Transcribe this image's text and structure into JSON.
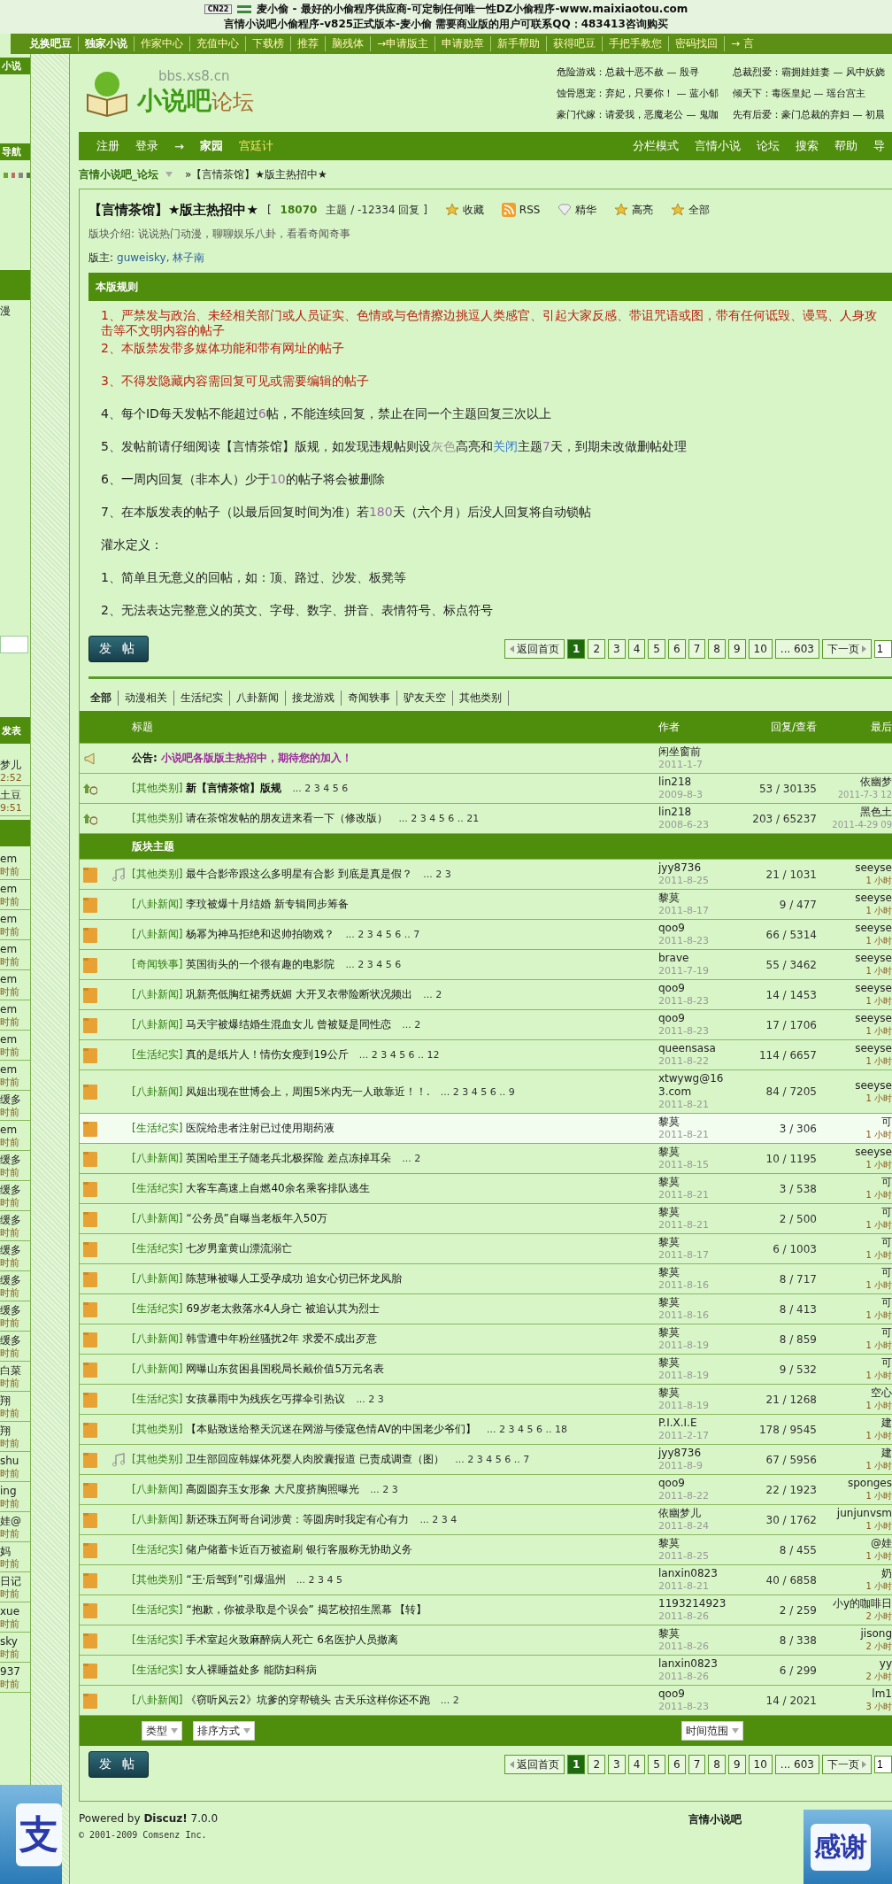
{
  "top_banner": {
    "widget": "CN22",
    "lines": [
      "麦小偷 - 最好的小偷程序供应商-可定制任何唯一性DZ小偷程序-www.maixiaotou.com",
      "言情小说吧小偷程序-v825正式版本-麦小偷  需要商业版的用户可联系QQ：483413咨询购买"
    ]
  },
  "top_nav": [
    "兑换吧豆",
    "独家小说",
    "作家中心",
    "充值中心",
    "下载榜",
    "推荐",
    "脑残体",
    "→申请版主",
    "申请勋章",
    "新手帮助",
    "获得吧豆",
    "手把手教您",
    "密码找回",
    "→ 言"
  ],
  "sidebar": {
    "header": "小说",
    "nav_label": "导航",
    "label": "漫",
    "post_label": "发表",
    "items": [
      {
        "name": "梦儿",
        "time": "2:52"
      },
      {
        "name": "土豆",
        "time": "9:51"
      },
      {
        "name": "em",
        "time": "时前"
      },
      {
        "name": "em",
        "time": "时前"
      },
      {
        "name": "em",
        "time": "时前"
      },
      {
        "name": "em",
        "time": "时前"
      },
      {
        "name": "em",
        "time": "时前"
      },
      {
        "name": "em",
        "time": "时前"
      },
      {
        "name": "em",
        "time": "时前"
      },
      {
        "name": "em",
        "time": "时前"
      },
      {
        "name": "缓多",
        "time": "时前"
      },
      {
        "name": "em",
        "time": "时前"
      },
      {
        "name": "缓多",
        "time": "时前"
      },
      {
        "name": "缓多",
        "time": "时前"
      },
      {
        "name": "缓多",
        "time": "时前"
      },
      {
        "name": "缓多",
        "time": "时前"
      },
      {
        "name": "缓多",
        "time": "时前"
      },
      {
        "name": "缓多",
        "time": "时前"
      },
      {
        "name": "缓多",
        "time": "时前"
      },
      {
        "name": "白菜",
        "time": "时前"
      },
      {
        "name": "翔",
        "time": "时前"
      },
      {
        "name": "翔",
        "time": "时前"
      },
      {
        "name": "shu",
        "time": "时前"
      },
      {
        "name": "ing",
        "time": "时前"
      },
      {
        "name": "娃@",
        "time": "时前"
      },
      {
        "name": "妈",
        "time": "时前"
      },
      {
        "name": "日记",
        "time": "时前"
      },
      {
        "name": "xue",
        "time": "时前"
      },
      {
        "name": "sky",
        "time": "时前"
      },
      {
        "name": "937",
        "time": "时前"
      }
    ]
  },
  "header": {
    "domain": "bbs.xs8.cn",
    "logo_main": "小说吧",
    "logo_sub": "论坛",
    "promos": [
      "危险游戏：总裁十恶不赦 — 殷寻",
      "总裁烈爱：霸拥娃娃妻 — 风中妖娆",
      "蚀骨恩宠：弃妃，只要你！ — 蓝小郁",
      "倾天下：毒医皇妃 — 瑶台宫主",
      "豪门代嫁：请爱我，恶魔老公 — 鬼咖",
      "先有后爱：豪门总裁的弃妇 — 初晨"
    ]
  },
  "nav": {
    "left": [
      {
        "label": "注册",
        "kind": "plain"
      },
      {
        "label": "登录",
        "kind": "plain"
      },
      {
        "label": "→",
        "kind": "plain"
      },
      {
        "label": "家园",
        "kind": "strong"
      },
      {
        "label": "宫廷计",
        "kind": "accent"
      }
    ],
    "right": [
      "分栏模式",
      "言情小说",
      "论坛",
      "搜索",
      "帮助",
      "导"
    ]
  },
  "breadcrumb": {
    "home": "言情小说吧_论坛",
    "separator": "»",
    "current": "【言情茶馆】★版主热招中★"
  },
  "forum": {
    "title": "【言情茶馆】★版主热招中★",
    "stats_open": "[",
    "topics": "18070",
    "stats_rest": "主题 / -12334 回复 ]",
    "actions": [
      {
        "label": "收藏",
        "kind": "star"
      },
      {
        "label": "RSS",
        "kind": "rss"
      },
      {
        "label": "精华",
        "kind": "diamond"
      },
      {
        "label": "高亮",
        "kind": "star"
      },
      {
        "label": "全部",
        "kind": "star"
      }
    ],
    "intro": "版块介绍: 说说热门动漫，聊聊娱乐八卦，看看奇闻奇事",
    "moderators_label": "版主:",
    "moderators": "guweisky, 林子南"
  },
  "rules": {
    "title": "本版规则",
    "items": [
      {
        "kind": "warning",
        "parts": [
          {
            "text": "1、严禁发与政治、未经相关部门或人员证实、色情或与色情擦边挑逗人类感官、引起大家反感、带诅咒语或图，带有任何诋毁、谩骂、人身攻击等不文明内容的帖子",
            "kind": "plain"
          }
        ]
      },
      {
        "kind": "warning",
        "parts": [
          {
            "text": "2、本版禁发带多媒体功能和带有网址的帖子",
            "kind": "plain"
          }
        ]
      },
      {
        "kind": "warning",
        "parts": [
          {
            "text": "3、不得发隐藏内容需回复可见或需要编辑的帖子",
            "kind": "plain"
          }
        ]
      },
      {
        "kind": "normal",
        "parts": [
          {
            "text": "4、每个ID每天发帖不能超过",
            "kind": "plain"
          },
          {
            "text": "6",
            "kind": "number"
          },
          {
            "text": "帖，不能连续回复，禁止在同一个主题回复三次以上",
            "kind": "plain"
          }
        ]
      },
      {
        "kind": "normal",
        "parts": [
          {
            "text": "5、发帖前请仔细阅读【言情茶馆】版规，如发现违规帖则设",
            "kind": "plain"
          },
          {
            "text": "灰色",
            "kind": "grey"
          },
          {
            "text": "高亮和",
            "kind": "plain"
          },
          {
            "text": "关闭",
            "kind": "blue"
          },
          {
            "text": "主题",
            "kind": "plain"
          },
          {
            "text": "7",
            "kind": "number"
          },
          {
            "text": "天，到期未改做删帖处理",
            "kind": "plain"
          }
        ]
      },
      {
        "kind": "normal",
        "parts": [
          {
            "text": "6、一周内回复（非本人）少于",
            "kind": "plain"
          },
          {
            "text": "10",
            "kind": "number"
          },
          {
            "text": "的帖子将会被删除",
            "kind": "plain"
          }
        ]
      },
      {
        "kind": "normal",
        "parts": [
          {
            "text": "7、在本版发表的帖子（以最后回复时间为准）若",
            "kind": "plain"
          },
          {
            "text": "180",
            "kind": "number"
          },
          {
            "text": "天（六个月）后没人回复将自动锁帖",
            "kind": "plain"
          }
        ]
      },
      {
        "kind": "normal",
        "parts": [
          {
            "text": "灌水定义：",
            "kind": "plain"
          }
        ]
      },
      {
        "kind": "normal",
        "parts": [
          {
            "text": "1、简单且无意义的回帖，如：顶、路过、沙发、板凳等",
            "kind": "plain"
          }
        ]
      },
      {
        "kind": "normal",
        "parts": [
          {
            "text": "2、无法表达完整意义的英文、字母、数字、拼音、表情符号、标点符号",
            "kind": "plain"
          }
        ]
      }
    ]
  },
  "pager_top": {
    "post_button": "发 帖",
    "back": "返回首页",
    "pages": [
      {
        "label": "1",
        "selected": true
      },
      {
        "label": "2",
        "selected": false
      },
      {
        "label": "3",
        "selected": false
      },
      {
        "label": "4",
        "selected": false
      },
      {
        "label": "5",
        "selected": false
      },
      {
        "label": "6",
        "selected": false
      },
      {
        "label": "7",
        "selected": false
      },
      {
        "label": "8",
        "selected": false
      },
      {
        "label": "9",
        "selected": false
      },
      {
        "label": "10",
        "selected": false
      },
      {
        "label": "... 603",
        "selected": false
      }
    ],
    "next": "下一页",
    "jump": "1"
  },
  "filters": [
    {
      "label": "全部",
      "selected": true
    },
    {
      "label": "动漫相关",
      "selected": false
    },
    {
      "label": "生活纪实",
      "selected": false
    },
    {
      "label": "八卦新闻",
      "selected": false
    },
    {
      "label": "接龙游戏",
      "selected": false
    },
    {
      "label": "奇闻轶事",
      "selected": false
    },
    {
      "label": "驴友天空",
      "selected": false
    },
    {
      "label": "其他类别",
      "selected": false
    }
  ],
  "table": {
    "columns": [
      "标题",
      "作者",
      "回复/查看",
      "最后"
    ],
    "announcement": {
      "label": "公告:",
      "text": "小说吧各版版主热招中，期待您的加入！",
      "author": "闲坐窗前",
      "date": "2011-1-7"
    },
    "sticky": [
      {
        "category": "[其他类别]",
        "title": "新【言情茶馆】版规",
        "pages": "... 2 3 4 5 6",
        "author": "lin218",
        "date": "2009-8-3",
        "counts": "53 / 30135",
        "last_user": "依幽梦",
        "last_time": "2011-7-3 12"
      },
      {
        "category": "[其他类别]",
        "title": "请在茶馆发帖的朋友进来看一下（修改版）",
        "pages": "... 2 3 4 5 6 .. 21",
        "author": "lin218",
        "date": "2008-6-23",
        "counts": "203 / 65237",
        "last_user": "黑色土",
        "last_time": "2011-4-29 09"
      }
    ],
    "section": "版块主题",
    "threads": [
      {
        "category": "[其他类别]",
        "title": "最牛合影帝跟这么多明星有合影 到底是真是假？",
        "pages": "... 2 3",
        "author": "jyy8736",
        "date": "2011-8-25",
        "counts": "21 / 1031",
        "last_user": "seeyse",
        "last_time": "1 小时",
        "audio": true,
        "highlighted": false
      },
      {
        "category": "[八卦新闻]",
        "title": "李玟被爆十月结婚 新专辑同步筹备",
        "author": "黎莫",
        "date": "2011-8-17",
        "counts": "9 / 477",
        "last_user": "seeyse",
        "last_time": "1 小时",
        "audio": false,
        "highlighted": false
      },
      {
        "category": "[八卦新闻]",
        "title": "杨幂为神马拒绝和迟帅拍吻戏？",
        "pages": "... 2 3 4 5 6 .. 7",
        "author": "qoo9",
        "date": "2011-8-23",
        "counts": "66 / 5314",
        "last_user": "seeyse",
        "last_time": "1 小时",
        "audio": false,
        "highlighted": false
      },
      {
        "category": "[奇闻轶事]",
        "title": "英国街头的一个很有趣的电影院",
        "pages": "... 2 3 4 5 6",
        "author": "brave",
        "date": "2011-7-19",
        "counts": "55 / 3462",
        "last_user": "seeyse",
        "last_time": "1 小时",
        "audio": false,
        "highlighted": false
      },
      {
        "category": "[八卦新闻]",
        "title": "巩新亮低胸红裙秀妩媚 大开叉衣带险断状况频出",
        "pages": "... 2",
        "author": "qoo9",
        "date": "2011-8-23",
        "counts": "14 / 1453",
        "last_user": "seeyse",
        "last_time": "1 小时",
        "audio": false,
        "highlighted": false
      },
      {
        "category": "[八卦新闻]",
        "title": "马天宇被爆结婚生混血女儿 曾被疑是同性恋",
        "pages": "... 2",
        "author": "qoo9",
        "date": "2011-8-23",
        "counts": "17 / 1706",
        "last_user": "seeyse",
        "last_time": "1 小时",
        "audio": false,
        "highlighted": false
      },
      {
        "category": "[生活纪实]",
        "title": "真的是纸片人！情伤女瘦到19公斤",
        "pages": "... 2 3 4 5 6 .. 12",
        "author": "queensasa",
        "date": "2011-8-22",
        "counts": "114 / 6657",
        "last_user": "seeyse",
        "last_time": "1 小时",
        "audio": false,
        "highlighted": false
      },
      {
        "category": "[八卦新闻]",
        "title": "凤姐出现在世博会上，周围5米内无一人敢靠近！！.",
        "pages": "... 2 3 4 5 6 .. 9",
        "author": "xtwywg@163.com",
        "date": "2011-8-21",
        "counts": "84 / 7205",
        "last_user": "seeyse",
        "last_time": "1 小时",
        "audio": false,
        "highlighted": false
      },
      {
        "category": "[生活纪实]",
        "title": "医院给患者注射已过使用期药液",
        "author": "黎莫",
        "date": "2011-8-21",
        "counts": "3 / 306",
        "last_user": "可",
        "last_time": "1 小时",
        "audio": false,
        "highlighted": true
      },
      {
        "category": "[八卦新闻]",
        "title": "英国哈里王子随老兵北极探险 差点冻掉耳朵",
        "pages": "... 2",
        "author": "黎莫",
        "date": "2011-8-15",
        "counts": "10 / 1195",
        "last_user": "seeyse",
        "last_time": "1 小时",
        "audio": false,
        "highlighted": false
      },
      {
        "category": "[生活纪实]",
        "title": "大客车高速上自燃40余名乘客排队逃生",
        "author": "黎莫",
        "date": "2011-8-21",
        "counts": "3 / 538",
        "last_user": "可",
        "last_time": "1 小时",
        "audio": false,
        "highlighted": false
      },
      {
        "category": "[八卦新闻]",
        "title": "“公务员”自曝当老板年入50万",
        "author": "黎莫",
        "date": "2011-8-21",
        "counts": "2 / 500",
        "last_user": "可",
        "last_time": "1 小时",
        "audio": false,
        "highlighted": false
      },
      {
        "category": "[生活纪实]",
        "title": "七岁男童黄山漂流溺亡",
        "author": "黎莫",
        "date": "2011-8-17",
        "counts": "6 / 1003",
        "last_user": "可",
        "last_time": "1 小时",
        "audio": false,
        "highlighted": false
      },
      {
        "category": "[八卦新闻]",
        "title": "陈慧琳被曝人工受孕成功 追女心切已怀龙凤胎",
        "author": "黎莫",
        "date": "2011-8-16",
        "counts": "8 / 717",
        "last_user": "可",
        "last_time": "1 小时",
        "audio": false,
        "highlighted": false
      },
      {
        "category": "[生活纪实]",
        "title": "69岁老太救落水4人身亡 被追认其为烈士",
        "author": "黎莫",
        "date": "2011-8-16",
        "counts": "8 / 413",
        "last_user": "可",
        "last_time": "1 小时",
        "audio": false,
        "highlighted": false
      },
      {
        "category": "[八卦新闻]",
        "title": "韩雪遭中年粉丝骚扰2年 求爱不成出歹意",
        "author": "黎莫",
        "date": "2011-8-19",
        "counts": "8 / 859",
        "last_user": "可",
        "last_time": "1 小时",
        "audio": false,
        "highlighted": false
      },
      {
        "category": "[八卦新闻]",
        "title": "网曝山东贫困县国税局长戴价值5万元名表",
        "author": "黎莫",
        "date": "2011-8-19",
        "counts": "9 / 532",
        "last_user": "可",
        "last_time": "1 小时",
        "audio": false,
        "highlighted": false
      },
      {
        "category": "[生活纪实]",
        "title": "女孩暴雨中为残疾乞丐撑伞引热议",
        "pages": "... 2 3",
        "author": "黎莫",
        "date": "2011-8-19",
        "counts": "21 / 1268",
        "last_user": "空心",
        "last_time": "1 小时",
        "audio": false,
        "highlighted": false
      },
      {
        "category": "[其他类别]",
        "title": "【本贴致送给整天沉迷在网游与倭寇色情AV的中国老少爷们】",
        "pages": "... 2 3 4 5 6 .. 18",
        "author": "P.I.X.I.E",
        "date": "2011-2-17",
        "counts": "178 / 9545",
        "last_user": "建",
        "last_time": "1 小时",
        "audio": false,
        "highlighted": false
      },
      {
        "category": "[其他类别]",
        "title": "卫生部回应韩媒体死婴人肉胶囊报道 已责成调查（图）",
        "pages": "... 2 3 4 5 6 .. 7",
        "author": "jyy8736",
        "date": "2011-8-9",
        "counts": "67 / 5956",
        "last_user": "建",
        "last_time": "1 小时",
        "audio": true,
        "highlighted": false
      },
      {
        "category": "[八卦新闻]",
        "title": "高圆圆弃玉女形象 大尺度挤胸照曝光",
        "pages": "... 2 3",
        "author": "qoo9",
        "date": "2011-8-22",
        "counts": "22 / 1923",
        "last_user": "sponges",
        "last_time": "1 小时",
        "audio": false,
        "highlighted": false
      },
      {
        "category": "[八卦新闻]",
        "title": "新还珠五阿哥台词涉黄：等圆房时我定有心有力",
        "pages": "... 2 3 4",
        "author": "依幽梦儿",
        "date": "2011-8-24",
        "counts": "30 / 1762",
        "last_user": "junjunvsm",
        "last_time": "1 小时",
        "audio": false,
        "highlighted": false
      },
      {
        "category": "[生活纪实]",
        "title": "储户储蓄卡近百万被盗刷 银行客服称无协助义务",
        "author": "黎莫",
        "date": "2011-8-25",
        "counts": "8 / 455",
        "last_user": "@娃",
        "last_time": "1 小时",
        "audio": false,
        "highlighted": false
      },
      {
        "category": "[其他类别]",
        "title": "“王·后驾到”引爆温州",
        "pages": "... 2 3 4 5",
        "author": "lanxin0823",
        "date": "2011-8-21",
        "counts": "40 / 6858",
        "last_user": "奶",
        "last_time": "1 小时",
        "audio": false,
        "highlighted": false
      },
      {
        "category": "[生活纪实]",
        "title": "“抱歉，你被录取是个误会” 揭艺校招生黑幕 【转】",
        "author": "1193214923",
        "date": "2011-8-26",
        "counts": "2 / 259",
        "last_user": "小y的咖啡日",
        "last_time": "2 小时",
        "audio": false,
        "highlighted": false
      },
      {
        "category": "[生活纪实]",
        "title": "手术室起火致麻醉病人死亡 6名医护人员撤离",
        "author": "黎莫",
        "date": "2011-8-26",
        "counts": "8 / 338",
        "last_user": "jisong",
        "last_time": "2 小时",
        "audio": false,
        "highlighted": false
      },
      {
        "category": "[生活纪实]",
        "title": "女人裸睡益处多 能防妇科病",
        "author": "lanxin0823",
        "date": "2011-8-26",
        "counts": "6 / 299",
        "last_user": "yy",
        "last_time": "2 小时",
        "audio": false,
        "highlighted": false
      },
      {
        "category": "[八卦新闻]",
        "title": "《窃听风云2》坑爹的穿帮镜头 古天乐这样你还不跑",
        "pages": "... 2",
        "author": "qoo9",
        "date": "2011-8-23",
        "counts": "14 / 2021",
        "last_user": "lm1",
        "last_time": "3 小时",
        "audio": false,
        "highlighted": false
      }
    ]
  },
  "table_footer": {
    "selects": [
      "类型",
      "排序方式",
      "时间范围"
    ]
  },
  "pager_bottom": {
    "post_button": "发 帖",
    "back": "返回首页",
    "pages": [
      {
        "label": "1",
        "selected": true
      },
      {
        "label": "2",
        "selected": false
      },
      {
        "label": "3",
        "selected": false
      },
      {
        "label": "4",
        "selected": false
      },
      {
        "label": "5",
        "selected": false
      },
      {
        "label": "6",
        "selected": false
      },
      {
        "label": "7",
        "selected": false
      },
      {
        "label": "8",
        "selected": false
      },
      {
        "label": "9",
        "selected": false
      },
      {
        "label": "10",
        "selected": false
      },
      {
        "label": "... 603",
        "selected": false
      }
    ],
    "next": "下一页",
    "jump": "1"
  },
  "footer": {
    "powered": "Powered by **Discuz!** 7.0.0",
    "copyright": "© 2001-2009 Comsenz Inc.",
    "site": "言情小说吧"
  },
  "floating_ads": [
    "支",
    "感谢"
  ]
}
